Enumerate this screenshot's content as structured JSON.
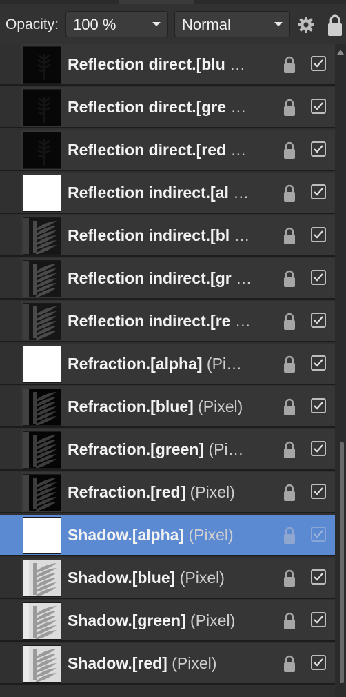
{
  "toolbar": {
    "opacity_label": "Opacity:",
    "opacity_value": "100 %",
    "blend_mode": "Normal"
  },
  "layers": [
    {
      "name": "Reflection direct.[blu",
      "kind": "…",
      "thumb": "dark",
      "selected": false
    },
    {
      "name": "Reflection direct.[gre",
      "kind": "…",
      "thumb": "dark",
      "selected": false
    },
    {
      "name": "Reflection direct.[red",
      "kind": "…",
      "thumb": "dark",
      "selected": false
    },
    {
      "name": "Reflection indirect.[al",
      "kind": "…",
      "thumb": "white",
      "selected": false
    },
    {
      "name": "Reflection indirect.[bl",
      "kind": "…",
      "thumb": "fern-dim",
      "selected": false
    },
    {
      "name": "Reflection indirect.[gr",
      "kind": "…",
      "thumb": "fern-dim",
      "selected": false
    },
    {
      "name": "Reflection indirect.[re",
      "kind": "…",
      "thumb": "fern-dim",
      "selected": false
    },
    {
      "name": "Refraction.[alpha]",
      "kind": "(Pi…",
      "thumb": "white",
      "selected": false
    },
    {
      "name": "Refraction.[blue]",
      "kind": "(Pixel)",
      "thumb": "fern-dark",
      "selected": false
    },
    {
      "name": "Refraction.[green]",
      "kind": "(Pi…",
      "thumb": "fern-dark",
      "selected": false
    },
    {
      "name": "Refraction.[red]",
      "kind": "(Pixel)",
      "thumb": "fern-dark",
      "selected": false
    },
    {
      "name": "Shadow.[alpha]",
      "kind": "(Pixel)",
      "thumb": "white",
      "selected": true
    },
    {
      "name": "Shadow.[blue]",
      "kind": "(Pixel)",
      "thumb": "fern-light",
      "selected": false
    },
    {
      "name": "Shadow.[green]",
      "kind": "(Pixel)",
      "thumb": "fern-light",
      "selected": false
    },
    {
      "name": "Shadow.[red]",
      "kind": "(Pixel)",
      "thumb": "fern-light",
      "selected": false
    }
  ],
  "colors": {
    "selection": "#5c8ad2",
    "row_bg": "#363636"
  }
}
